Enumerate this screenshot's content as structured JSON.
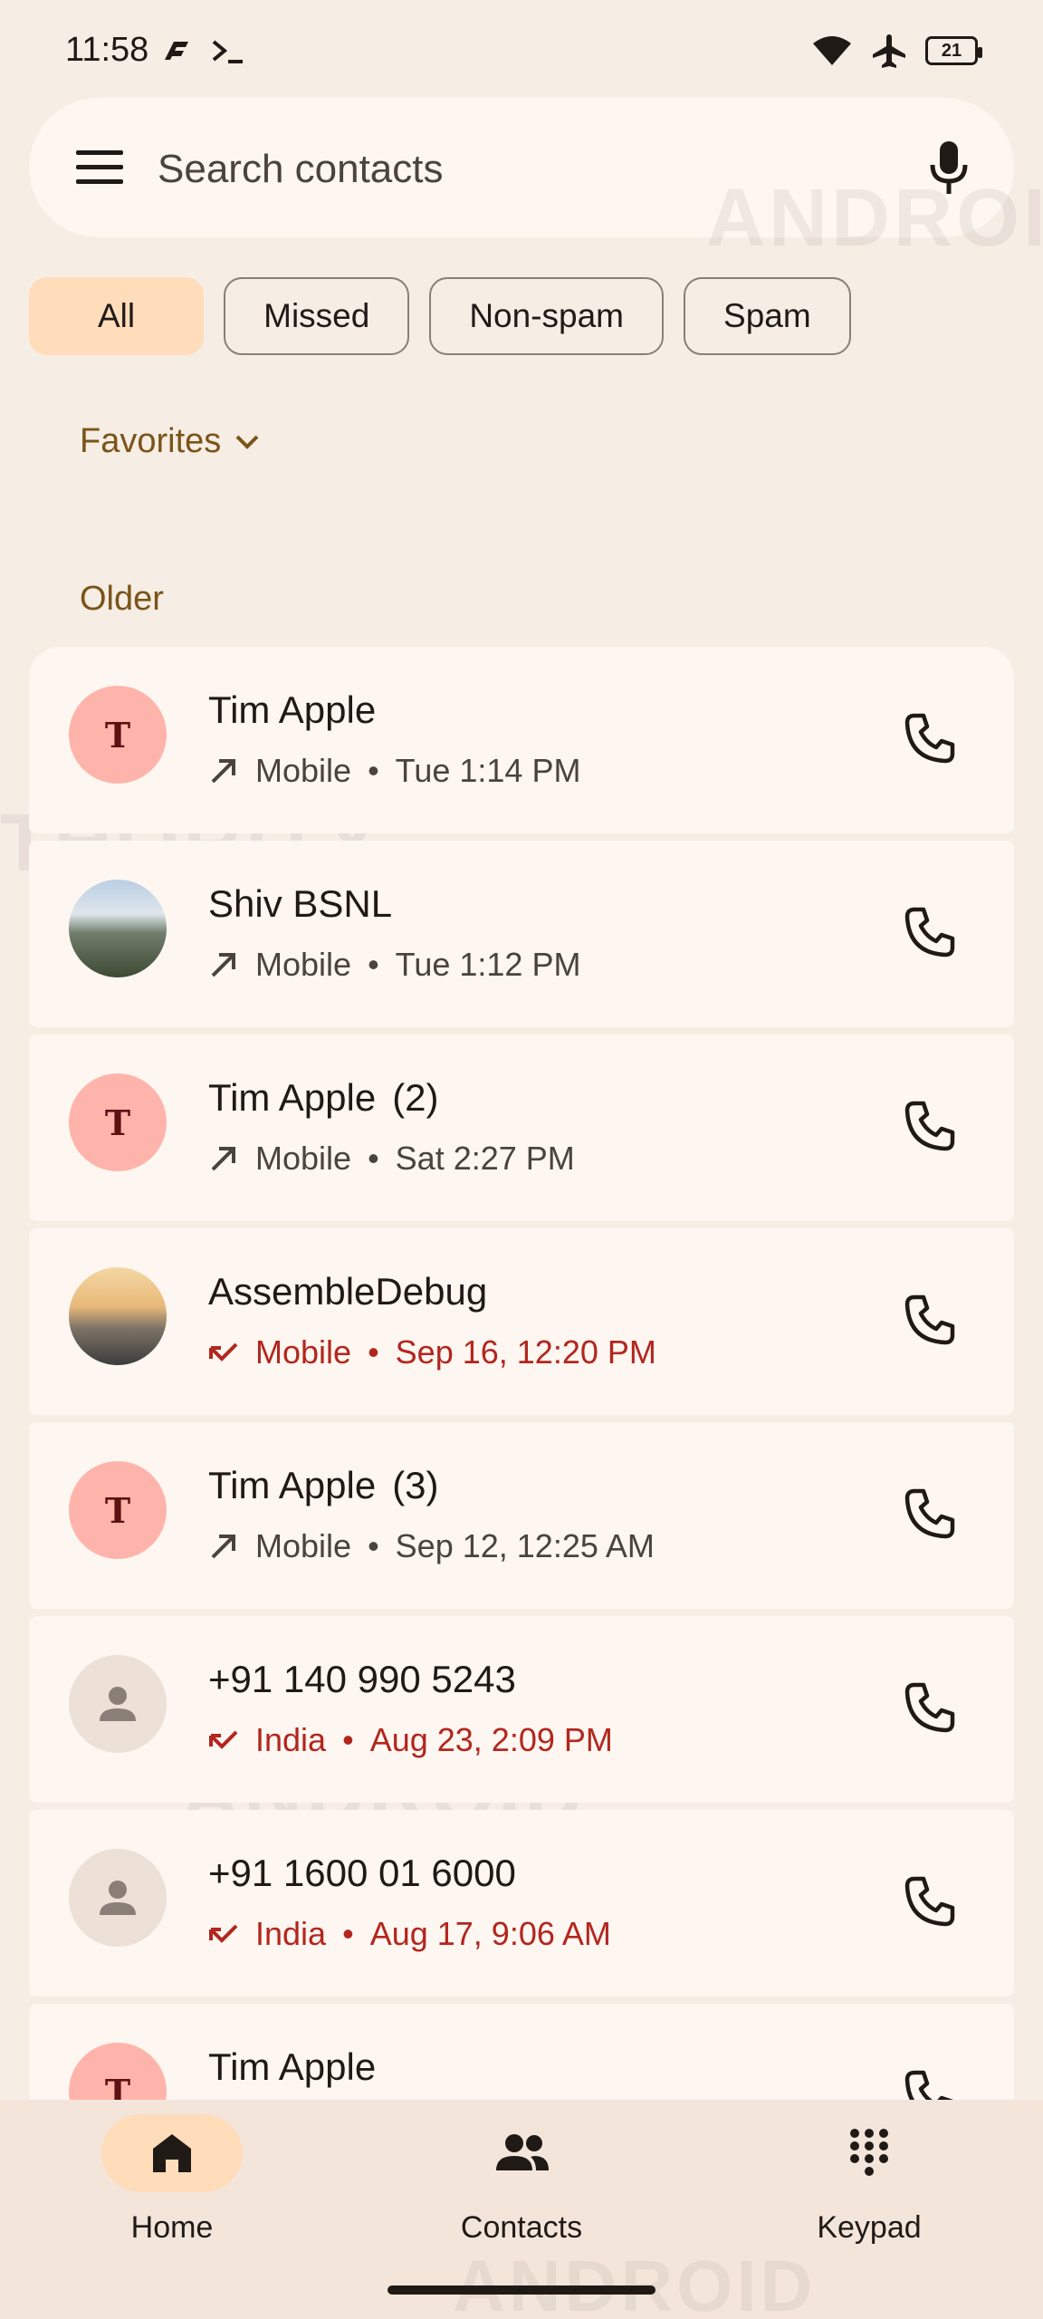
{
  "status_bar": {
    "time": "11:58",
    "battery": "21"
  },
  "search": {
    "placeholder": "Search contacts"
  },
  "filters": [
    {
      "label": "All",
      "active": true
    },
    {
      "label": "Missed",
      "active": false
    },
    {
      "label": "Non-spam",
      "active": false
    },
    {
      "label": "Spam",
      "active": false
    }
  ],
  "favorites_label": "Favorites",
  "older_label": "Older",
  "calls": [
    {
      "name": "Tim Apple",
      "count": "",
      "avatar": "T",
      "avatar_type": "letter",
      "direction": "outgoing",
      "type": "Mobile",
      "time": "Tue 1:14 PM"
    },
    {
      "name": "Shiv BSNL",
      "count": "",
      "avatar": "",
      "avatar_type": "photo-mountain",
      "direction": "outgoing",
      "type": "Mobile",
      "time": "Tue 1:12 PM"
    },
    {
      "name": "Tim Apple",
      "count": "(2)",
      "avatar": "T",
      "avatar_type": "letter",
      "direction": "outgoing",
      "type": "Mobile",
      "time": "Sat 2:27 PM"
    },
    {
      "name": "AssembleDebug",
      "count": "",
      "avatar": "",
      "avatar_type": "photo-sunset",
      "direction": "missed",
      "type": "Mobile",
      "time": "Sep 16, 12:20 PM"
    },
    {
      "name": "Tim Apple",
      "count": "(3)",
      "avatar": "T",
      "avatar_type": "letter",
      "direction": "outgoing",
      "type": "Mobile",
      "time": "Sep 12, 12:25 AM"
    },
    {
      "name": "+91 140 990 5243",
      "count": "",
      "avatar": "",
      "avatar_type": "unknown",
      "direction": "missed",
      "type": "India",
      "time": "Aug 23, 2:09 PM"
    },
    {
      "name": "+91 1600 01 6000",
      "count": "",
      "avatar": "",
      "avatar_type": "unknown",
      "direction": "missed",
      "type": "India",
      "time": "Aug 17, 9:06 AM"
    },
    {
      "name": "Tim Apple",
      "count": "",
      "avatar": "T",
      "avatar_type": "letter",
      "direction": "outgoing",
      "type": "",
      "time": ""
    }
  ],
  "nav": [
    {
      "label": "Home",
      "icon": "home-icon",
      "active": true
    },
    {
      "label": "Contacts",
      "icon": "contacts-icon",
      "active": false
    },
    {
      "label": "Keypad",
      "icon": "keypad-icon",
      "active": false
    }
  ],
  "colors": {
    "background": "#f6ede5",
    "card": "#fdf6f1",
    "accent": "#ffdcba",
    "missed": "#b3261e",
    "section": "#7a5418"
  }
}
